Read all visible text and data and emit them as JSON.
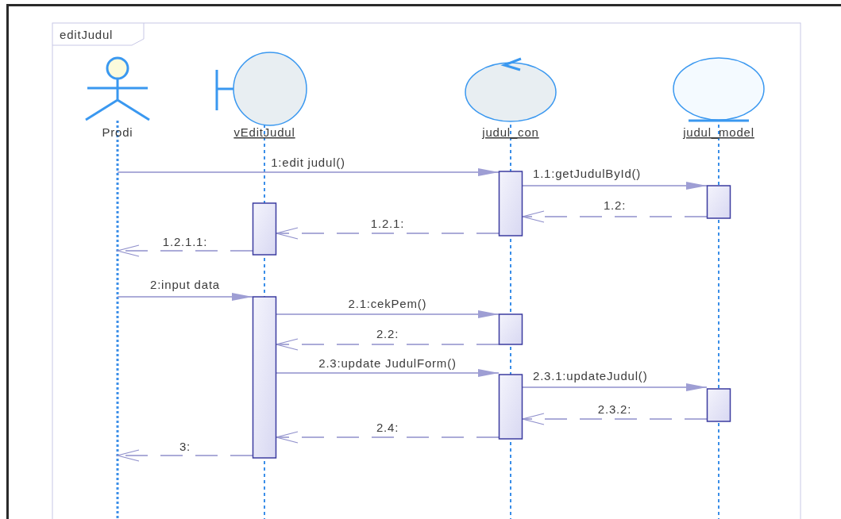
{
  "diagram": {
    "title": "editJudul"
  },
  "participants": [
    {
      "name": "Prodi",
      "kind": "actor"
    },
    {
      "name": "vEditJudul",
      "kind": "boundary"
    },
    {
      "name": "judul_con",
      "kind": "control"
    },
    {
      "name": "judul_model",
      "kind": "entity"
    }
  ],
  "messages": [
    {
      "label": "1:edit judul()",
      "kind": "call"
    },
    {
      "label": "1.1:getJudulById()",
      "kind": "call"
    },
    {
      "label": "1.2:",
      "kind": "return"
    },
    {
      "label": "1.2.1:",
      "kind": "return"
    },
    {
      "label": "1.2.1.1:",
      "kind": "return"
    },
    {
      "label": "2:input data",
      "kind": "call"
    },
    {
      "label": "2.1:cekPem()",
      "kind": "call"
    },
    {
      "label": "2.2:",
      "kind": "return"
    },
    {
      "label": "2.3:update JudulForm()",
      "kind": "call"
    },
    {
      "label": "2.3.1:updateJudul()",
      "kind": "call"
    },
    {
      "label": "2.3.2:",
      "kind": "return"
    },
    {
      "label": "2.4:",
      "kind": "return"
    },
    {
      "label": "3:",
      "kind": "return"
    }
  ]
}
